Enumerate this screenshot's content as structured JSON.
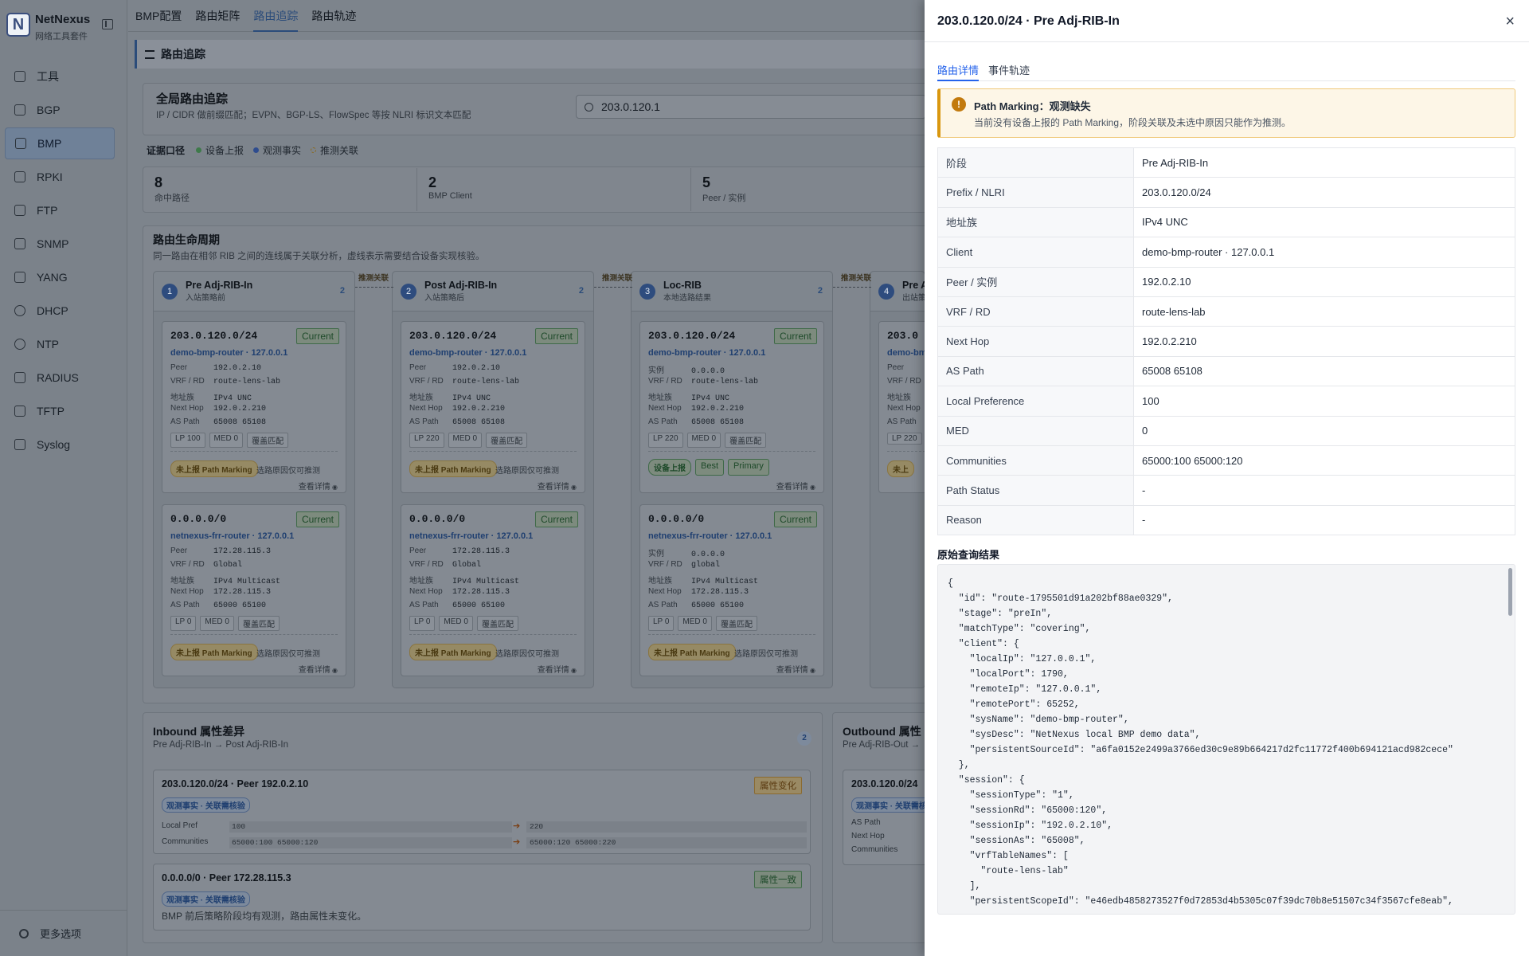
{
  "app": {
    "name": "NetNexus",
    "subtitle": "网络工具套件",
    "logo": "N"
  },
  "sidebar": {
    "items": [
      {
        "label": "工具",
        "icon": "grid-icon"
      },
      {
        "label": "BGP",
        "icon": "routes-icon"
      },
      {
        "label": "BMP",
        "icon": "chart-icon",
        "active": true
      },
      {
        "label": "RPKI",
        "icon": "shield-icon"
      },
      {
        "label": "FTP",
        "icon": "folder-icon"
      },
      {
        "label": "SNMP",
        "icon": "code-icon"
      },
      {
        "label": "YANG",
        "icon": "file-icon"
      },
      {
        "label": "DHCP",
        "icon": "wifi-icon"
      },
      {
        "label": "NTP",
        "icon": "clock-icon"
      },
      {
        "label": "RADIUS",
        "icon": "key-icon"
      },
      {
        "label": "TFTP",
        "icon": "transfer-icon"
      },
      {
        "label": "Syslog",
        "icon": "log-icon"
      }
    ],
    "more": "更多选项"
  },
  "topnav": {
    "tabs": [
      "BMP配置",
      "路由矩阵",
      "路由追踪",
      "路由轨迹"
    ],
    "active": 2
  },
  "section": {
    "title": "路由追踪"
  },
  "global": {
    "title": "全局路由追踪",
    "desc": "IP / CIDR 做前缀匹配；EVPN、BGP-LS、FlowSpec 等按 NLRI 标识文本匹配",
    "search_value": "203.0.120.1"
  },
  "legend": {
    "title": "证据口径",
    "items": [
      {
        "label": "设备上报",
        "color": "#3e7a4a"
      },
      {
        "label": "观测事实",
        "color": "#2e4c8e"
      },
      {
        "label": "推测关联",
        "color": "#8a6a20"
      }
    ]
  },
  "stats": [
    {
      "value": "8",
      "label": "命中路径"
    },
    {
      "value": "2",
      "label": "BMP Client"
    },
    {
      "value": "5",
      "label": "Peer / 实例"
    }
  ],
  "lifecycle": {
    "title": "路由生命周期",
    "desc": "同一路由在相邻 RIB 之间的连线属于关联分析，虚线表示需要结合设备实现核验。",
    "connector_label": "推测关联",
    "columns": [
      {
        "step": "1",
        "name": "Pre Adj-RIB-In",
        "sub": "入站策略前",
        "count": "2",
        "routes": [
          {
            "prefix": "203.0.120.0/24",
            "badge": "Current",
            "device": "demo-bmp-router · 127.0.0.1",
            "kv": [
              [
                "Peer",
                "192.0.2.10"
              ],
              [
                "VRF / RD",
                "route-lens-lab"
              ],
              [
                "地址族",
                "IPv4 UNC"
              ],
              [
                "Next Hop",
                "192.0.2.210"
              ],
              [
                "AS Path",
                "65008 65108"
              ]
            ],
            "chips": [
              "LP 100",
              "MED 0",
              "覆盖匹配"
            ],
            "pm": "未上报 Path Marking",
            "pm_note": "选路原因仅可推测",
            "link": "查看详情"
          },
          {
            "prefix": "0.0.0.0/0",
            "badge": "Current",
            "device": "netnexus-frr-router · 127.0.0.1",
            "kv": [
              [
                "Peer",
                "172.28.115.3"
              ],
              [
                "VRF / RD",
                "Global"
              ],
              [
                "地址族",
                "IPv4 Multicast"
              ],
              [
                "Next Hop",
                "172.28.115.3"
              ],
              [
                "AS Path",
                "65000 65100"
              ]
            ],
            "chips": [
              "LP 0",
              "MED 0",
              "覆盖匹配"
            ],
            "pm": "未上报 Path Marking",
            "pm_note": "选路原因仅可推测",
            "link": "查看详情"
          }
        ]
      },
      {
        "step": "2",
        "name": "Post Adj-RIB-In",
        "sub": "入站策略后",
        "count": "2",
        "routes": [
          {
            "prefix": "203.0.120.0/24",
            "badge": "Current",
            "device": "demo-bmp-router · 127.0.0.1",
            "kv": [
              [
                "Peer",
                "192.0.2.10"
              ],
              [
                "VRF / RD",
                "route-lens-lab"
              ],
              [
                "地址族",
                "IPv4 UNC"
              ],
              [
                "Next Hop",
                "192.0.2.210"
              ],
              [
                "AS Path",
                "65008 65108"
              ]
            ],
            "chips": [
              "LP 220",
              "MED 0",
              "覆盖匹配"
            ],
            "pm": "未上报 Path Marking",
            "pm_note": "选路原因仅可推测",
            "link": "查看详情"
          },
          {
            "prefix": "0.0.0.0/0",
            "badge": "Current",
            "device": "netnexus-frr-router · 127.0.0.1",
            "kv": [
              [
                "Peer",
                "172.28.115.3"
              ],
              [
                "VRF / RD",
                "Global"
              ],
              [
                "地址族",
                "IPv4 Multicast"
              ],
              [
                "Next Hop",
                "172.28.115.3"
              ],
              [
                "AS Path",
                "65000 65100"
              ]
            ],
            "chips": [
              "LP 0",
              "MED 0",
              "覆盖匹配"
            ],
            "pm": "未上报 Path Marking",
            "pm_note": "选路原因仅可推测",
            "link": "查看详情"
          }
        ]
      },
      {
        "step": "3",
        "name": "Loc-RIB",
        "sub": "本地选路结果",
        "count": "2",
        "routes": [
          {
            "prefix": "203.0.120.0/24",
            "badge": "Current",
            "device": "demo-bmp-router · 127.0.0.1",
            "kv": [
              [
                "实例",
                "0.0.0.0"
              ],
              [
                "VRF / RD",
                "route-lens-lab"
              ],
              [
                "地址族",
                "IPv4 UNC"
              ],
              [
                "Next Hop",
                "192.0.2.210"
              ],
              [
                "AS Path",
                "65008 65108"
              ]
            ],
            "chips": [
              "LP 220",
              "MED 0",
              "覆盖匹配"
            ],
            "green": [
              "设备上报",
              "Best",
              "Primary"
            ],
            "link": "查看详情"
          },
          {
            "prefix": "0.0.0.0/0",
            "badge": "Current",
            "device": "netnexus-frr-router · 127.0.0.1",
            "kv": [
              [
                "实例",
                "0.0.0.0"
              ],
              [
                "VRF / RD",
                "global"
              ],
              [
                "地址族",
                "IPv4 Multicast"
              ],
              [
                "Next Hop",
                "172.28.115.3"
              ],
              [
                "AS Path",
                "65000 65100"
              ]
            ],
            "chips": [
              "LP 0",
              "MED 0",
              "覆盖匹配"
            ],
            "pm": "未上报 Path Marking",
            "pm_note": "选路原因仅可推测",
            "link": "查看详情"
          }
        ]
      },
      {
        "step": "4",
        "name": "Pre A",
        "sub": "出站策",
        "count": "",
        "routes": [
          {
            "prefix": "203.0",
            "badge": "",
            "device": "demo-bm",
            "kv": [
              [
                "Peer",
                ""
              ],
              [
                "VRF / RD",
                ""
              ],
              [
                "地址族",
                ""
              ],
              [
                "Next Hop",
                ""
              ],
              [
                "AS Path",
                ""
              ]
            ],
            "chips": [
              "LP 220"
            ],
            "pm": "未上",
            "pm_note": "",
            "link": ""
          }
        ]
      }
    ]
  },
  "inbound": {
    "title": "Inbound 属性差异",
    "sub": "Pre Adj-RIB-In → Post Adj-RIB-In",
    "count": "2",
    "diffs": [
      {
        "title": "203.0.120.0/24 · Peer 192.0.2.10",
        "tag": "属性变化",
        "obs": "观测事实 · 关联需核验",
        "rows": [
          {
            "key": "Local Pref",
            "before": "100",
            "after": "220"
          },
          {
            "key": "Communities",
            "before": "65000:100 65000:120",
            "after": "65000:120 65000:220"
          }
        ]
      },
      {
        "title": "0.0.0.0/0 · Peer 172.28.115.3",
        "tag": "属性一致",
        "obs": "观测事实 · 关联需核验",
        "note": "BMP 前后策略阶段均有观测，路由属性未变化。"
      }
    ]
  },
  "outbound": {
    "title": "Outbound 属性",
    "sub": "Pre Adj-RIB-Out →",
    "diff_title": "203.0.120.0/24",
    "obs": "观测事实 · 关联需核验",
    "rows": [
      "AS Path",
      "Next Hop",
      "Communities"
    ]
  },
  "drawer": {
    "title": "203.0.120.0/24 · Pre Adj-RIB-In",
    "close": "×",
    "tabs": [
      "路由详情",
      "事件轨迹"
    ],
    "alert": {
      "icon": "!",
      "title": "Path Marking：观测缺失",
      "desc": "当前没有设备上报的 Path Marking，阶段关联及未选中原因只能作为推测。"
    },
    "rows": [
      [
        "阶段",
        "Pre Adj-RIB-In"
      ],
      [
        "Prefix / NLRI",
        "203.0.120.0/24"
      ],
      [
        "地址族",
        "IPv4 UNC"
      ],
      [
        "Client",
        "demo-bmp-router · 127.0.0.1"
      ],
      [
        "Peer / 实例",
        "192.0.2.10"
      ],
      [
        "VRF / RD",
        "route-lens-lab"
      ],
      [
        "Next Hop",
        "192.0.2.210"
      ],
      [
        "AS Path",
        "65008 65108"
      ],
      [
        "Local Preference",
        "100"
      ],
      [
        "MED",
        "0"
      ],
      [
        "Communities",
        "65000:100 65000:120"
      ],
      [
        "Path Status",
        "-"
      ],
      [
        "Reason",
        "-"
      ]
    ],
    "raw_title": "原始查询结果",
    "raw": "{\n  \"id\": \"route-1795501d91a202bf88ae0329\",\n  \"stage\": \"preIn\",\n  \"matchType\": \"covering\",\n  \"client\": {\n    \"localIp\": \"127.0.0.1\",\n    \"localPort\": 1790,\n    \"remoteIp\": \"127.0.0.1\",\n    \"remotePort\": 65252,\n    \"sysName\": \"demo-bmp-router\",\n    \"sysDesc\": \"NetNexus local BMP demo data\",\n    \"persistentSourceId\": \"a6fa0152e2499a3766ed30c9e89b664217d2fc11772f400b694121acd982cece\"\n  },\n  \"session\": {\n    \"sessionType\": \"1\",\n    \"sessionRd\": \"65000:120\",\n    \"sessionIp\": \"192.0.2.10\",\n    \"sessionAs\": \"65008\",\n    \"vrfTableNames\": [\n      \"route-lens-lab\"\n    ],\n    \"persistentScopeId\": \"e46edb4858273527f0d72853d4b5305c07f39dc70b8e51507c34f3567cfe8eab\","
  }
}
